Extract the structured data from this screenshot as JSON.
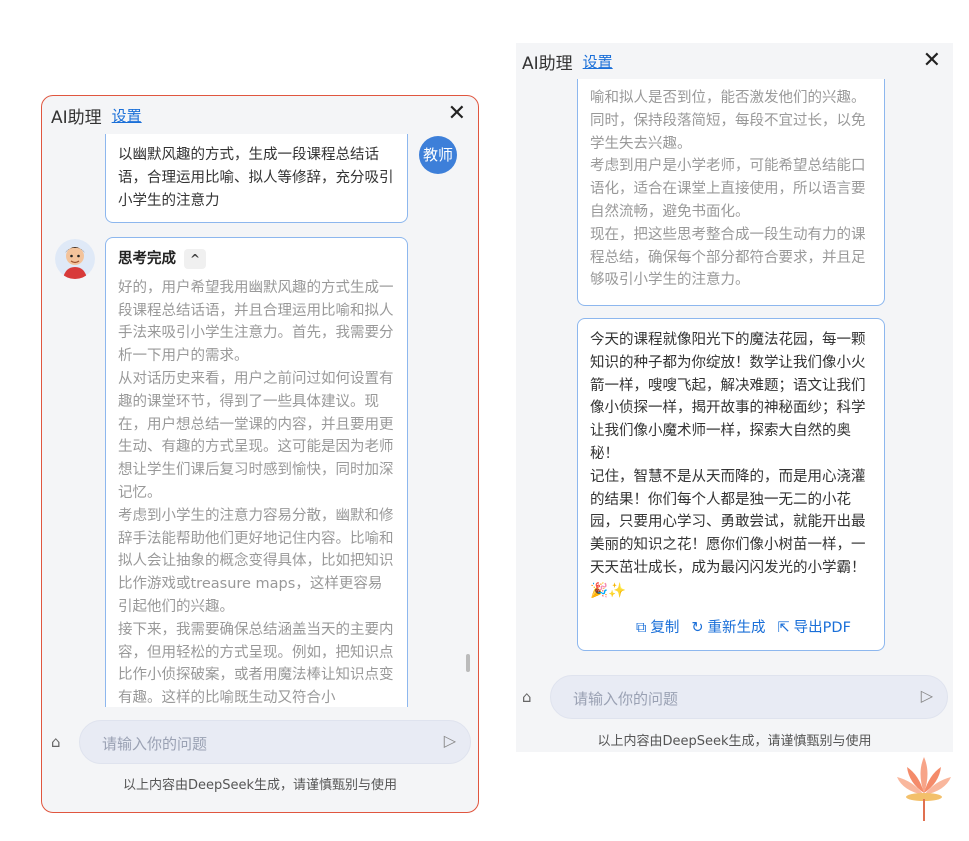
{
  "left": {
    "header": {
      "title": "AI助理",
      "settings": "设置",
      "close": "✕"
    },
    "user": {
      "avatar": "教师",
      "message": "以幽默风趣的方式，生成一段课程总结话语，合理运用比喻、拟人等修辞，充分吸引小学生的注意力"
    },
    "ai": {
      "think_title": "思考完成",
      "think_toggle": "^",
      "think_paragraphs": [
        "好的，用户希望我用幽默风趣的方式生成一段课程总结话语，并且合理运用比喻和拟人手法来吸引小学生注意力。首先，我需要分析一下用户的需求。",
        "从对话历史来看，用户之前问过如何设置有趣的课堂环节，得到了一些具体建议。现在，用户想总结一堂课的内容，并且要用更生动、有趣的方式呈现。这可能是因为老师想让学生们课后复习时感到愉快，同时加深记忆。",
        "考虑到小学生的注意力容易分散，幽默和修辞手法能帮助他们更好地记住内容。比喻和拟人会让抽象的概念变得具体，比如把知识比作游戏或treasure maps，这样更容易引起他们的兴趣。",
        "接下来，我需要确保总结涵盖当天的主要内容，但用轻松的方式呈现。例如，把知识点比作小侦探破案，或者用魔法棒让知识点变有趣。这样的比喻既生动又符合小"
      ]
    },
    "input_placeholder": "请输入你的问题",
    "footer": "以上内容由DeepSeek生成，请谨慎甄别与使用"
  },
  "right": {
    "header": {
      "title": "AI助理",
      "settings": "设置",
      "close": "✕"
    },
    "think_paragraphs": [
      "喻和拟人是否到位，能否激发他们的兴趣。同时，保持段落简短，每段不宜过长，以免学生失去兴趣。",
      "考虑到用户是小学老师，可能希望总结能口语化，适合在课堂上直接使用，所以语言要自然流畅，避免书面化。",
      "现在，把这些思考整合成一段生动有力的课程总结，确保每个部分都符合要求，并且足够吸引小学生的注意力。"
    ],
    "answer_paragraphs": [
      "今天的课程就像阳光下的魔法花园，每一颗知识的种子都为你绽放！数学让我们像小火箭一样，嗖嗖飞起，解决难题；语文让我们像小侦探一样，揭开故事的神秘面纱；科学让我们像小魔术师一样，探索大自然的奥秘！",
      "记住，智慧不是从天而降的，而是用心浇灌的结果！你们每个人都是独一无二的小花园，只要用心学习、勇敢尝试，就能开出最美丽的知识之花！愿你们像小树苗一样，一天天茁壮成长，成为最闪闪发光的小学霸！🎉✨"
    ],
    "actions": {
      "copy": "复制",
      "regen": "重新生成",
      "export": "导出PDF"
    },
    "input_placeholder": "请输入你的问题",
    "footer": "以上内容由DeepSeek生成，请谨慎甄别与使用"
  },
  "colors": {
    "accent": "#1a6fd8",
    "bubble_border": "#8db7ee",
    "panel_border": "#e0563f",
    "avatar_bg": "#3d7fd9"
  },
  "icons": {
    "clean": "broom-icon",
    "send": "send-icon",
    "copy": "copy-icon",
    "regen": "refresh-icon",
    "export": "export-icon",
    "lotus": "lotus-icon"
  }
}
